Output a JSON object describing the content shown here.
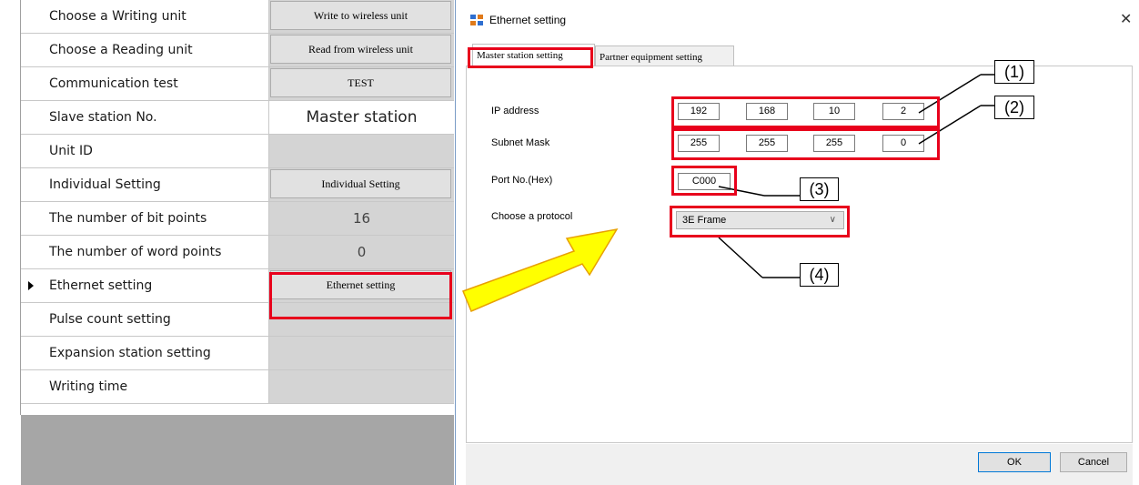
{
  "grid": {
    "rows": [
      {
        "label": "Choose a Writing unit",
        "button": "Write to wireless unit"
      },
      {
        "label": "Choose a Reading unit",
        "button": "Read from wireless unit"
      },
      {
        "label": "Communication test",
        "button": "TEST"
      },
      {
        "label": "Slave station No.",
        "value": "Master station"
      },
      {
        "label": "Unit ID"
      },
      {
        "label": "Individual Setting",
        "button": "Individual Setting"
      },
      {
        "label": "The number of bit points",
        "value": "16"
      },
      {
        "label": "The number of word points",
        "value": "0"
      },
      {
        "label": "Ethernet setting",
        "button": "Ethernet setting",
        "selected": true
      },
      {
        "label": "Pulse count setting"
      },
      {
        "label": "Expansion station setting"
      },
      {
        "label": "Writing time"
      }
    ]
  },
  "dialog": {
    "title": "Ethernet setting",
    "tabs": [
      "Master station setting",
      "Partner equipment setting"
    ],
    "ip_address": {
      "label": "IP address",
      "octets": [
        "192",
        "168",
        "10",
        "2"
      ]
    },
    "subnet_mask": {
      "label": "Subnet Mask",
      "octets": [
        "255",
        "255",
        "255",
        "0"
      ]
    },
    "port": {
      "label": "Port No.(Hex)",
      "value": "C000"
    },
    "protocol": {
      "label": "Choose a protocol",
      "selected": "3E Frame"
    },
    "buttons": {
      "ok": "OK",
      "cancel": "Cancel"
    }
  },
  "annotations": {
    "callouts": [
      "(1)",
      "(2)",
      "(3)",
      "(4)"
    ],
    "highlight_color": "#e8001c",
    "arrow_fill": "#ffff00"
  },
  "icons": {
    "window": "ethernet-app-icon",
    "close": "close-icon",
    "dropdown": "chevron-down-icon",
    "row_pointer": "row-pointer-icon"
  }
}
